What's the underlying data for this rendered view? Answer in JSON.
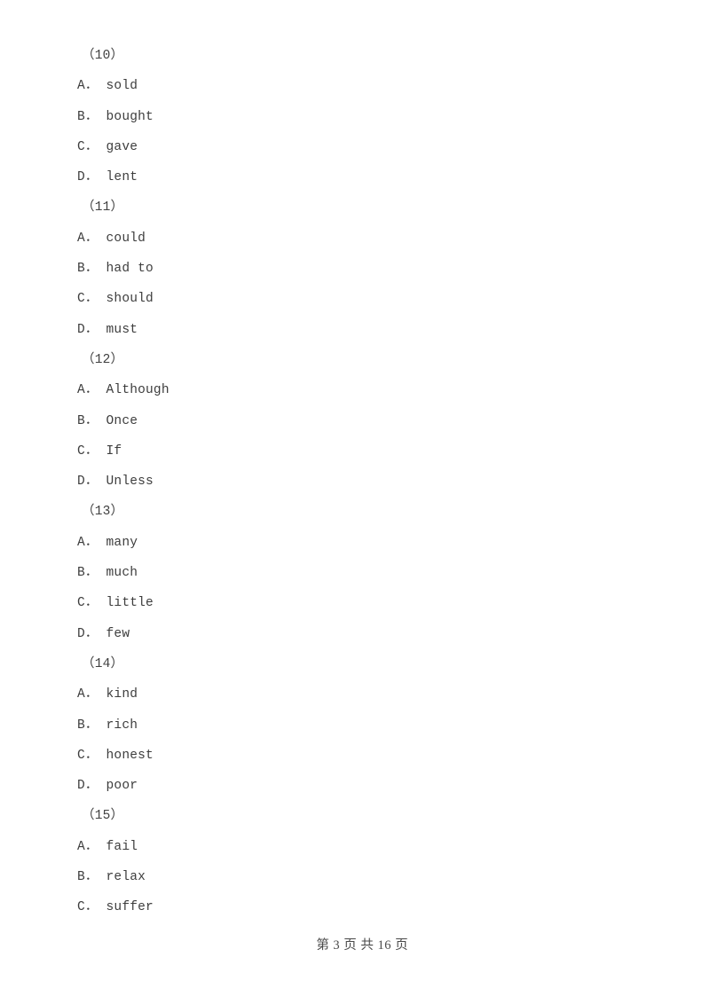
{
  "document": {
    "type": "exam-paper-page",
    "background_color": "#ffffff",
    "text_color": "#3d3d3d"
  },
  "questions": [
    {
      "number": "（10）",
      "options": [
        {
          "letter": "A",
          "separator": "．",
          "text": "sold"
        },
        {
          "letter": "B",
          "separator": "．",
          "text": "bought"
        },
        {
          "letter": "C",
          "separator": "．",
          "text": "gave"
        },
        {
          "letter": "D",
          "separator": "．",
          "text": "lent"
        }
      ]
    },
    {
      "number": "（11）",
      "options": [
        {
          "letter": "A",
          "separator": "．",
          "text": "could"
        },
        {
          "letter": "B",
          "separator": "．",
          "text": "had to"
        },
        {
          "letter": "C",
          "separator": "．",
          "text": "should"
        },
        {
          "letter": "D",
          "separator": "．",
          "text": "must"
        }
      ]
    },
    {
      "number": "（12）",
      "options": [
        {
          "letter": "A",
          "separator": "．",
          "text": "Although"
        },
        {
          "letter": "B",
          "separator": "．",
          "text": "Once"
        },
        {
          "letter": "C",
          "separator": "．",
          "text": "If"
        },
        {
          "letter": "D",
          "separator": "．",
          "text": "Unless"
        }
      ]
    },
    {
      "number": "（13）",
      "options": [
        {
          "letter": "A",
          "separator": "．",
          "text": "many"
        },
        {
          "letter": "B",
          "separator": "．",
          "text": "much"
        },
        {
          "letter": "C",
          "separator": "．",
          "text": "little"
        },
        {
          "letter": "D",
          "separator": "．",
          "text": "few"
        }
      ]
    },
    {
      "number": "（14）",
      "options": [
        {
          "letter": "A",
          "separator": "．",
          "text": "kind"
        },
        {
          "letter": "B",
          "separator": "．",
          "text": "rich"
        },
        {
          "letter": "C",
          "separator": "．",
          "text": "honest"
        },
        {
          "letter": "D",
          "separator": "．",
          "text": "poor"
        }
      ]
    },
    {
      "number": "（15）",
      "options": [
        {
          "letter": "A",
          "separator": "．",
          "text": "fail"
        },
        {
          "letter": "B",
          "separator": "．",
          "text": "relax"
        },
        {
          "letter": "C",
          "separator": "．",
          "text": "suffer"
        }
      ]
    }
  ],
  "footer": {
    "text": "第 3 页 共 16 页",
    "current_page": "3",
    "total_pages": "16"
  }
}
